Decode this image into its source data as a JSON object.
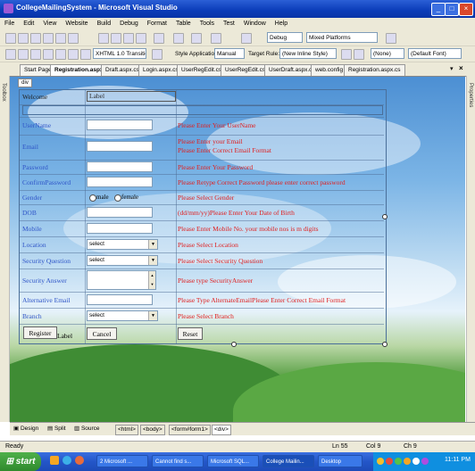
{
  "window": {
    "title": "CollegeMailingSystem - Microsoft Visual Studio"
  },
  "menu": [
    "File",
    "Edit",
    "View",
    "Website",
    "Build",
    "Debug",
    "Format",
    "Table",
    "Tools",
    "Test",
    "Window",
    "Help"
  ],
  "toolbar1": {
    "config": "Debug",
    "platform": "Mixed Platforms"
  },
  "toolbar2": {
    "doctype": "XHTML 1.0 Transitional (",
    "style_app_label": "Style Application:",
    "style_app_value": "Manual",
    "target_rule_label": "Target Rule:",
    "target_rule_value": "(New Inline Style)",
    "style_value": "(None)",
    "font_value": "(Default Font)"
  },
  "tabs": [
    "Start Page",
    "Registration.aspx",
    "Draft.aspx.cs",
    "Login.aspx.cs",
    "UserRegEdit.cs",
    "UserRegEdit.cs",
    "UserDraft.aspx.cs",
    "web.config",
    "Registration.aspx.cs"
  ],
  "side": {
    "left": "Toolbox",
    "right": "Properties"
  },
  "div_tag": "div",
  "form": {
    "welcome": "Welcome",
    "label_placeholder": "Label",
    "rows": [
      {
        "label": "UserName",
        "error": "Please Enter Your UserName"
      },
      {
        "label": "Email",
        "error": "Please Enter your Email",
        "error2": "Please Enter Correct Email Format"
      },
      {
        "label": "Password",
        "error": "Please Enter Your Password"
      },
      {
        "label": "ConfirmPassword",
        "error": "Please Retype Correct Password please enter correct password"
      },
      {
        "label": "Gender",
        "error": "Please Select Gender",
        "male": "male",
        "female": "female"
      },
      {
        "label": "DOB",
        "error": "(dd/mm/yy)Please Enter Your Date of Birth"
      },
      {
        "label": "Mobile",
        "error": "Please Enter Mobile No. your mobile nos is m digits"
      },
      {
        "label": "Location",
        "error": "Please Select Location",
        "select": "select"
      },
      {
        "label": "Security Question",
        "error": "Please Select Security Question",
        "select": "select"
      },
      {
        "label": "Security Answer",
        "error": "Please type SecurityAnswer"
      },
      {
        "label": "Alternative Email",
        "error": "Please Type AlternateEmailPlease Enter Correct Email Format"
      },
      {
        "label": "Branch",
        "error": "Please Select Branch",
        "select": "select"
      }
    ],
    "register_btn": "Register",
    "label_text": "Label",
    "cancel_btn": "Cancel",
    "reset_btn": "Reset"
  },
  "viewbar": {
    "design": "Design",
    "split": "Split",
    "source": "Source",
    "crumbs": [
      "<html>",
      "<body>",
      "<form#form1>",
      "<div>"
    ]
  },
  "status": {
    "ready": "Ready",
    "ln": "Ln 55",
    "col": "Col 9",
    "ch": "Ch 9"
  },
  "taskbar": {
    "start": "start",
    "tasks": [
      "2 Microsoft ...",
      "Cannot find s...",
      "Microsoft SQL...",
      "College Mailin...",
      "Desktop"
    ],
    "time": "11:11 PM"
  }
}
